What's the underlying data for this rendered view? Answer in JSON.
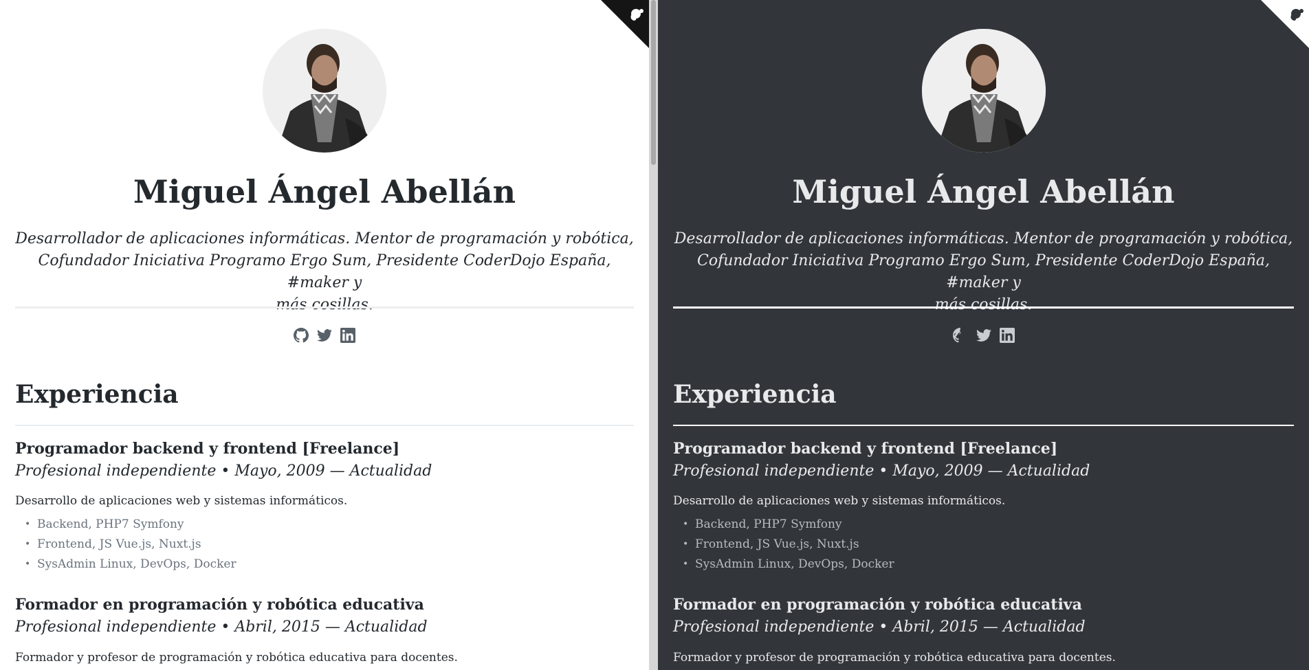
{
  "profile": {
    "name": "Miguel Ángel Abellán",
    "tagline_lines": [
      "Desarrollador de aplicaciones informáticas. Mentor de programación y robótica,",
      "Cofundador Iniciativa Programo Ergo Sum, Presidente CoderDojo España, #maker y",
      "más cosillas."
    ]
  },
  "social": [
    "github-icon",
    "twitter-icon",
    "linkedin-icon"
  ],
  "experience": {
    "heading": "Experiencia",
    "jobs": [
      {
        "title": "Programador backend y frontend [Freelance]",
        "meta": "Profesional independiente • Mayo, 2009 — Actualidad",
        "description": "Desarrollo de aplicaciones web y sistemas informáticos.",
        "items": [
          "Backend, PHP7 Symfony",
          "Frontend, JS Vue.js, Nuxt.js",
          "SysAdmin Linux, DevOps, Docker"
        ]
      },
      {
        "title": "Formador en programación y robótica educativa",
        "meta": "Profesional independiente • Abril, 2015 — Actualidad",
        "description": "Formador y profesor de programación y robótica educativa para docentes."
      }
    ]
  },
  "theme": {
    "light_bg": "#ffffff",
    "dark_bg": "#32363b",
    "corner_icon": "chameleon-icon"
  }
}
